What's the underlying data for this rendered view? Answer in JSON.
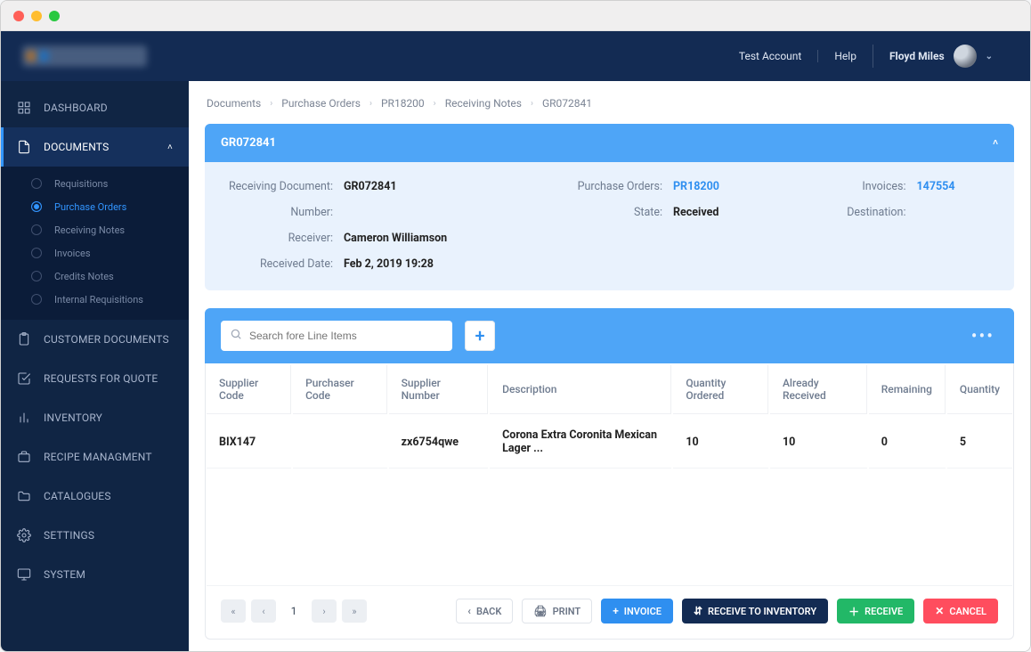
{
  "topbar": {
    "test_account": "Test Account",
    "help": "Help",
    "user_name": "Floyd Miles"
  },
  "sidebar": {
    "items": [
      {
        "label": "DASHBOARD"
      },
      {
        "label": "DOCUMENTS"
      },
      {
        "label": "CUSTOMER DOCUMENTS"
      },
      {
        "label": "REQUESTS FOR QUOTE"
      },
      {
        "label": "INVENTORY"
      },
      {
        "label": "RECIPE MANAGMENT"
      },
      {
        "label": "CATALOGUES"
      },
      {
        "label": "SETTINGS"
      },
      {
        "label": "SYSTEM"
      }
    ],
    "doc_sub": [
      {
        "label": "Requisitions"
      },
      {
        "label": "Purchase Orders"
      },
      {
        "label": "Receiving Notes"
      },
      {
        "label": "Invoices"
      },
      {
        "label": "Credits Notes"
      },
      {
        "label": "Internal Requisitions"
      }
    ]
  },
  "breadcrumbs": [
    "Documents",
    "Purchase Orders",
    "PR18200",
    "Receiving Notes",
    "GR072841"
  ],
  "panel": {
    "title": "GR072841",
    "fields": {
      "receiving_doc_label": "Receiving Document:",
      "receiving_doc_value": "GR072841",
      "number_label": "Number:",
      "number_value": "",
      "receiver_label": "Receiver:",
      "receiver_value": "Cameron Williamson",
      "received_date_label": "Received Date:",
      "received_date_value": "Feb 2, 2019 19:28",
      "purchase_orders_label": "Purchase Orders:",
      "purchase_orders_value": "PR18200",
      "state_label": "State:",
      "state_value": "Received",
      "invoices_label": "Invoices:",
      "invoices_value": "147554",
      "destination_label": "Destination:",
      "destination_value": ""
    }
  },
  "table": {
    "search_placeholder": "Search fore Line Items",
    "cols": {
      "supplier_code": "Supplier Code",
      "purchaser_code": "Purchaser Code",
      "supplier_number": "Supplier Number",
      "description": "Description",
      "qty_ordered": "Quantity Ordered",
      "already_received": "Already Received",
      "remaining": "Remaining",
      "quantity": "Quantity"
    },
    "rows": [
      {
        "supplier_code": "BIX147",
        "purchaser_code": "",
        "supplier_number": "zx6754qwe",
        "description": "Corona Extra Coronita Mexican Lager ...",
        "qty_ordered": "10",
        "already_received": "10",
        "remaining": "0",
        "quantity": "5"
      }
    ],
    "page": "1"
  },
  "actions": {
    "back": "BACK",
    "print": "PRINT",
    "invoice": "INVOICE",
    "receive_inventory": "RECEIVE TO INVENTORY",
    "receive": "RECEIVE",
    "cancel": "CANCEL"
  }
}
